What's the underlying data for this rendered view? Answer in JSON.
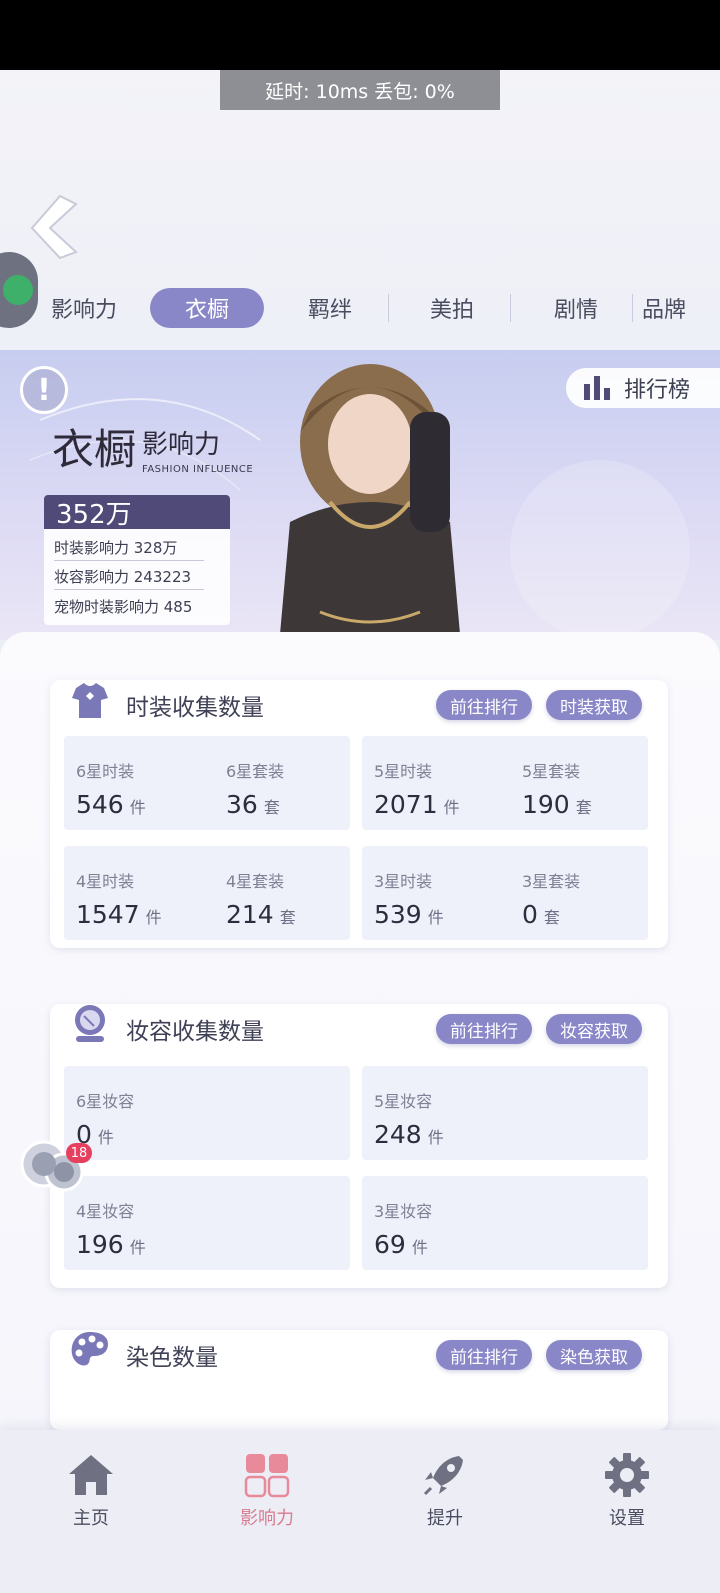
{
  "status": {
    "network": "延时: 10ms 丢包: 0%"
  },
  "tabs": [
    {
      "label": "影响力"
    },
    {
      "label": "衣橱"
    },
    {
      "label": "羁绊"
    },
    {
      "label": "美拍"
    },
    {
      "label": "剧情"
    },
    {
      "label": "品牌"
    }
  ],
  "active_tab": "衣橱",
  "banner": {
    "title_main": "衣橱",
    "title_sub": "影响力",
    "title_en": "FASHION INFLUENCE",
    "total": "352万",
    "lines": [
      {
        "text": "时装影响力 328万"
      },
      {
        "text": "妆容影响力 243223"
      },
      {
        "text": "宠物时装影响力 485"
      }
    ],
    "rank_label": "排行榜"
  },
  "fashion": {
    "title": "时装收集数量",
    "btn_rank": "前往排行",
    "btn_get": "时装获取",
    "stats": [
      {
        "label": "6星时装",
        "value": "546",
        "unit": "件"
      },
      {
        "label": "6星套装",
        "value": "36",
        "unit": "套"
      },
      {
        "label": "5星时装",
        "value": "2071",
        "unit": "件"
      },
      {
        "label": "5星套装",
        "value": "190",
        "unit": "套"
      },
      {
        "label": "4星时装",
        "value": "1547",
        "unit": "件"
      },
      {
        "label": "4星套装",
        "value": "214",
        "unit": "套"
      },
      {
        "label": "3星时装",
        "value": "539",
        "unit": "件"
      },
      {
        "label": "3星套装",
        "value": "0",
        "unit": "套"
      }
    ]
  },
  "makeup": {
    "title": "妆容收集数量",
    "btn_rank": "前往排行",
    "btn_get": "妆容获取",
    "stats": [
      {
        "label": "6星妆容",
        "value": "0",
        "unit": "件"
      },
      {
        "label": "5星妆容",
        "value": "248",
        "unit": "件"
      },
      {
        "label": "4星妆容",
        "value": "196",
        "unit": "件"
      },
      {
        "label": "3星妆容",
        "value": "69",
        "unit": "件"
      }
    ]
  },
  "dye": {
    "title": "染色数量",
    "btn_rank": "前往排行",
    "btn_get": "染色获取"
  },
  "floater": {
    "badge": "18"
  },
  "nav": [
    {
      "label": "主页"
    },
    {
      "label": "影响力"
    },
    {
      "label": "提升"
    },
    {
      "label": "设置"
    }
  ],
  "colors": {
    "accent": "#8a87c8",
    "nav_active": "#d97c90",
    "badge": "#e5405d"
  },
  "icons": [
    "back-chevron-icon",
    "warning-icon",
    "bar-chart-icon",
    "tshirt-icon",
    "mirror-icon",
    "palette-icon",
    "home-icon",
    "grid-icon",
    "rocket-icon",
    "gear-icon"
  ]
}
